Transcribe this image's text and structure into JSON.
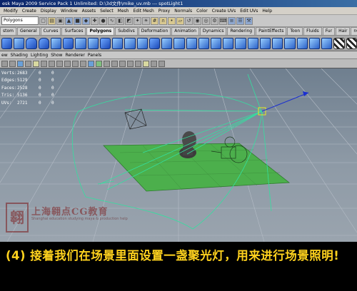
{
  "window": {
    "title": "esk Maya 2009 Service Pack 1 Unlimited: D:\\3d文件\\mike_uv.mb  ---  spotLight1"
  },
  "menubar": {
    "items": [
      "Modify",
      "Create",
      "Display",
      "Window",
      "Assets",
      "Select",
      "Mesh",
      "Edit Mesh",
      "Proxy",
      "Normals",
      "Color",
      "Create UVs",
      "Edit UVs",
      "Help"
    ]
  },
  "statusline": {
    "mode_value": "Polygons"
  },
  "shelf_tabs": {
    "items": [
      "stom",
      "General",
      "Curves",
      "Surfaces",
      "Polygons",
      "Subdivs",
      "Deformation",
      "Animation",
      "Dynamics",
      "Rendering",
      "PaintEffects",
      "Toon",
      "Fluids",
      "Fur",
      "Hair",
      "nCloth"
    ],
    "active": "Polygons"
  },
  "panel_menu": {
    "items": [
      "ew",
      "Shading",
      "Lighting",
      "Show",
      "Renderer",
      "Panels"
    ]
  },
  "hud": {
    "rows": [
      {
        "label": "Verts:",
        "value": "2683",
        "a": "0",
        "b": "0"
      },
      {
        "label": "Edges:",
        "value": "5129",
        "a": "0",
        "b": "0"
      },
      {
        "label": "Faces:",
        "value": "2528",
        "a": "0",
        "b": "0"
      },
      {
        "label": "Tris:",
        "value": "5136",
        "a": "0",
        "b": "0"
      },
      {
        "label": "UVs:",
        "value": "2721",
        "a": "0",
        "b": "0"
      }
    ]
  },
  "watermark": {
    "title": "上海翱点CG教育",
    "subtitle": "Shanghai education studying maya & production help",
    "logo_char": "翱"
  },
  "caption": {
    "text": "(4) 接着我们在场景里面设置一盏聚光灯，用来进行场景照明!"
  },
  "colors": {
    "ground_plane": "#4caf4c",
    "light_wire": "#33e0a0",
    "manipulator_arrow": "#1a2fd0",
    "caption_text": "#ffd21e",
    "selection_box": "#e8e820"
  }
}
